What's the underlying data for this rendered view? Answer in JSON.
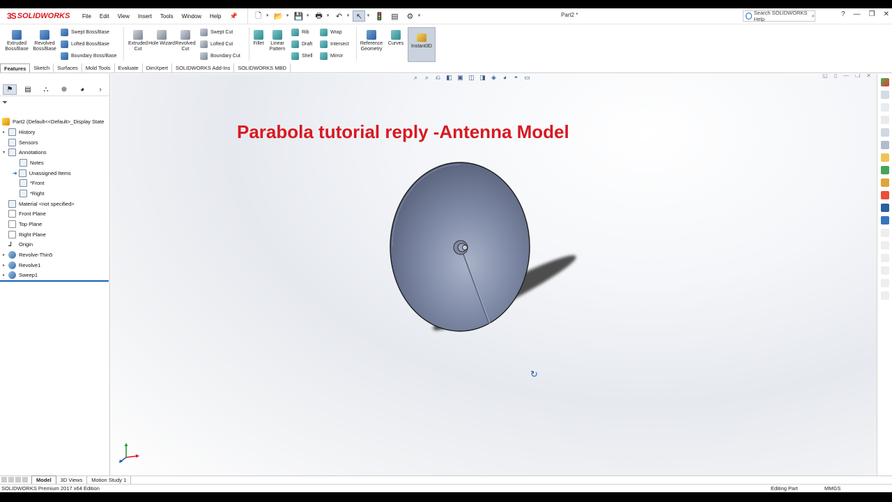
{
  "app": {
    "brand": "SOLIDWORKS",
    "document_title": "Part2 *"
  },
  "menu": [
    "File",
    "Edit",
    "View",
    "Insert",
    "Tools",
    "Window",
    "Help"
  ],
  "help_search": {
    "placeholder": "Search SOLIDWORKS Help"
  },
  "command_manager": {
    "extruded_boss": "Extruded Boss/Base",
    "revolved_boss": "Revolved Boss/Base",
    "swept_boss": "Swept Boss/Base",
    "lofted_boss": "Lofted Boss/Base",
    "boundary_boss": "Boundary Boss/Base",
    "extruded_cut": "Extruded Cut",
    "hole_wizard": "Hole Wizard",
    "revolved_cut": "Revolved Cut",
    "swept_cut": "Swept Cut",
    "lofted_cut": "Lofted Cut",
    "boundary_cut": "Boundary Cut",
    "fillet": "Fillet",
    "linear_pattern": "Linear Pattern",
    "rib": "Rib",
    "draft": "Draft",
    "shell": "Shell",
    "wrap": "Wrap",
    "intersect": "Intersect",
    "mirror": "Mirror",
    "reference_geometry": "Reference Geometry",
    "curves": "Curves",
    "instant3d": "Instant3D"
  },
  "cm_tabs": [
    "Features",
    "Sketch",
    "Surfaces",
    "Mold Tools",
    "Evaluate",
    "DimXpert",
    "SOLIDWORKS Add-Ins",
    "SOLIDWORKS MBD"
  ],
  "tree": {
    "root": "Part2  (Default<<Default>_Display State",
    "history": "History",
    "sensors": "Sensors",
    "annotations": "Annotations",
    "notes": "Notes",
    "unassigned": "Unassigned Items",
    "front_view": "*Front",
    "right_view": "*Right",
    "material": "Material <not specified>",
    "front_plane": "Front Plane",
    "top_plane": "Top Plane",
    "right_plane": "Right Plane",
    "origin": "Origin",
    "revolve_thin": "Revolve-Thin5",
    "revolve1": "Revolve1",
    "sweep1": "Sweep1"
  },
  "viewport": {
    "title": "Parabola tutorial reply -Antenna Model"
  },
  "bottom_tabs": [
    "Model",
    "3D Views",
    "Motion Study 1"
  ],
  "status": {
    "edition": "SOLIDWORKS Premium 2017 x64 Edition",
    "editing": "Editing Part",
    "units": "MMGS"
  },
  "colors": {
    "brand_red": "#d71921",
    "dish_body": "#6f7c96"
  }
}
